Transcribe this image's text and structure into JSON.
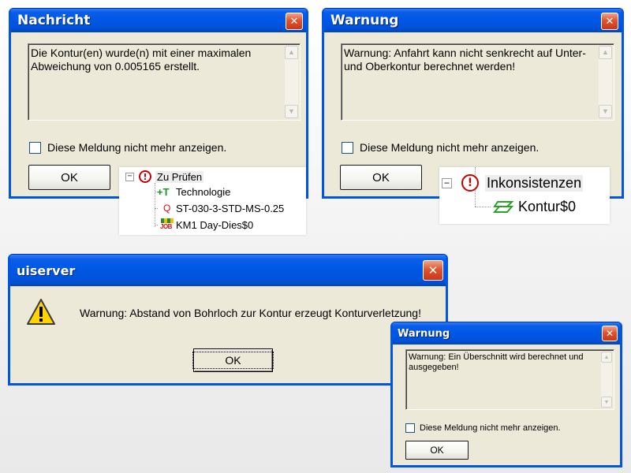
{
  "dialog1": {
    "title": "Nachricht",
    "close_glyph": "✕",
    "message": "Die Kontur(en) wurde(n) mit einer maximalen Abweichung von 0.005165 erstellt.",
    "checkbox_label": "Diese Meldung nicht mehr anzeigen.",
    "ok_label": "OK"
  },
  "dialog2": {
    "title": "Warnung",
    "close_glyph": "✕",
    "message": "Warnung: Anfahrt kann nicht senkrecht auf Unter- und Oberkontur berechnet werden!",
    "checkbox_label": "Diese Meldung nicht mehr anzeigen.",
    "ok_label": "OK"
  },
  "tree1": {
    "expander": "−",
    "root_label": "Zu Prüfen",
    "items": [
      {
        "icon_text": "+T",
        "label": "Technologie",
        "icon_color": "#1a9a1a"
      },
      {
        "icon_text": "Q",
        "label": "ST-030-3-STD-MS-0.25",
        "icon_color": "#d01010"
      },
      {
        "icon_text": "JOB",
        "label": "KM1 Day-Dies$0",
        "icon_color": "#d01010"
      }
    ]
  },
  "tree2": {
    "expander": "−",
    "root_label": "Inkonsistenzen",
    "items": [
      {
        "label": "Kontur$0",
        "icon_color": "#2aa12a"
      }
    ]
  },
  "dialog3": {
    "title": "uiserver",
    "close_glyph": "✕",
    "icon_glyph": "!",
    "message": "Warnung: Abstand von Bohrloch zur Kontur erzeugt Konturverletzung!",
    "ok_label": "OK"
  },
  "dialog4": {
    "title": "Warnung",
    "close_glyph": "✕",
    "message": "Warnung: Ein Überschnitt wird berechnet und ausgegeben!",
    "checkbox_label": "Diese Meldung nicht mehr anzeigen.",
    "ok_label": "OK"
  },
  "colors": {
    "titlebar": "#0058e6",
    "dialog_face": "#ece9d8",
    "close_button": "#e0532d",
    "warning_red": "#c40000"
  }
}
